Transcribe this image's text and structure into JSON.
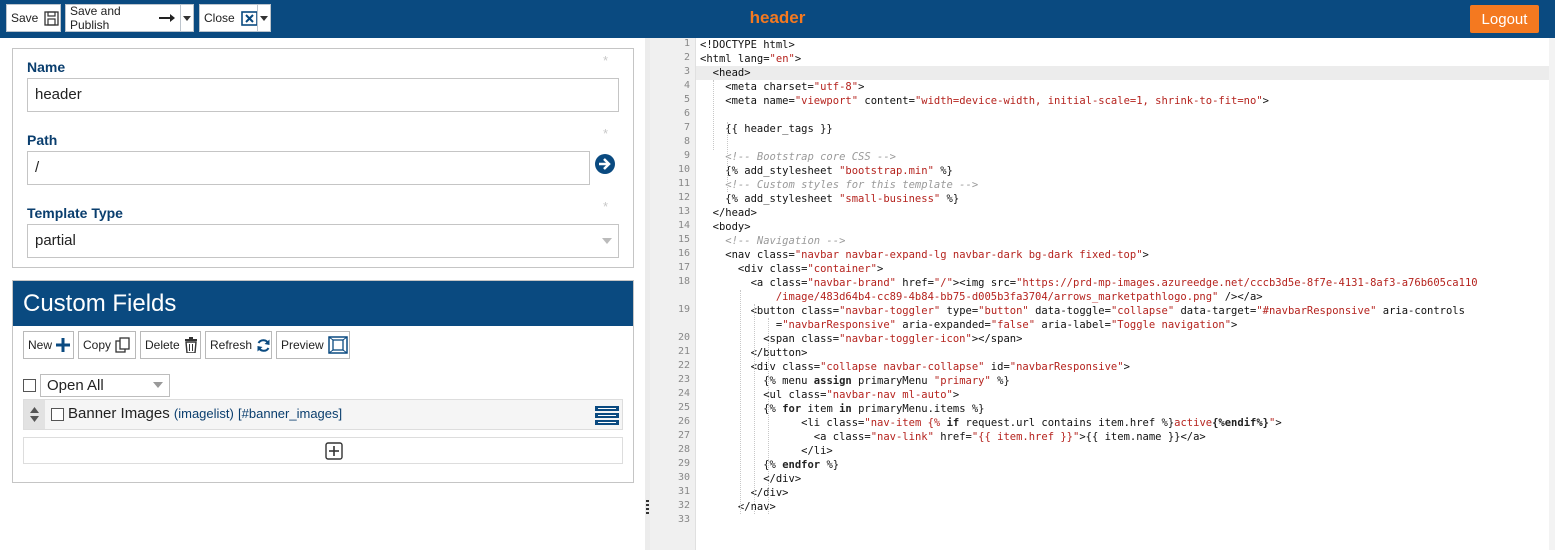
{
  "toolbar": {
    "save_label": "Save",
    "save_publish_label": "Save and Publish",
    "close_label": "Close",
    "title": "header",
    "logout_label": "Logout"
  },
  "form": {
    "name_label": "Name",
    "name_value": "header",
    "path_label": "Path",
    "path_value": "/",
    "template_type_label": "Template Type",
    "template_type_value": "partial",
    "required_marker": "*"
  },
  "custom_fields": {
    "title": "Custom Fields",
    "buttons": [
      "New",
      "Copy",
      "Delete",
      "Refresh",
      "Preview"
    ],
    "open_all": "Open All",
    "rows": [
      {
        "name": "Banner Images",
        "type": "(imagelist)",
        "key": "[#banner_images]"
      }
    ]
  },
  "editor": {
    "line_numbers": [
      "1",
      "2",
      "3",
      "4",
      "5",
      "6",
      "7",
      "8",
      "9",
      "10",
      "11",
      "12",
      "13",
      "14",
      "15",
      "16",
      "17",
      "18",
      "",
      "19",
      "",
      "20",
      "21",
      "22",
      "23",
      "24",
      "25",
      "26",
      "27",
      "28",
      "29",
      "30",
      "31",
      "32",
      "33"
    ],
    "lines": [
      [
        [
          "",
          "<!DOCTYPE html>"
        ]
      ],
      [
        [
          "",
          "<html lang="
        ],
        [
          "s",
          "\"en\""
        ],
        [
          "",
          ">"
        ]
      ],
      [
        [
          "",
          "  <head>"
        ]
      ],
      [
        [
          "",
          "    <meta charset="
        ],
        [
          "s",
          "\"utf-8\""
        ],
        [
          "",
          ">"
        ]
      ],
      [
        [
          "",
          "    <meta name="
        ],
        [
          "s",
          "\"viewport\""
        ],
        [
          "",
          " content="
        ],
        [
          "s",
          "\"width=device-width, initial-scale=1, shrink-to-fit=no\""
        ],
        [
          "",
          ">"
        ]
      ],
      [
        [
          "",
          ""
        ]
      ],
      [
        [
          "",
          "    {{ header_tags }}"
        ]
      ],
      [
        [
          "",
          ""
        ]
      ],
      [
        [
          "c",
          "    <!-- Bootstrap core CSS -->"
        ]
      ],
      [
        [
          "",
          "    {% add_stylesheet "
        ],
        [
          "s",
          "\"bootstrap.min\""
        ],
        [
          "",
          " %}"
        ]
      ],
      [
        [
          "c",
          "    <!-- Custom styles for this template -->"
        ]
      ],
      [
        [
          "",
          "    {% add_stylesheet "
        ],
        [
          "s",
          "\"small-business\""
        ],
        [
          "",
          " %}"
        ]
      ],
      [
        [
          "",
          "  </head>"
        ]
      ],
      [
        [
          "",
          "  <body>"
        ]
      ],
      [
        [
          "c",
          "    <!-- Navigation -->"
        ]
      ],
      [
        [
          "",
          "    <nav class="
        ],
        [
          "s",
          "\"navbar navbar-expand-lg navbar-dark bg-dark fixed-top\""
        ],
        [
          "",
          ">"
        ]
      ],
      [
        [
          "",
          "      <div class="
        ],
        [
          "s",
          "\"container\""
        ],
        [
          "",
          ">"
        ]
      ],
      [
        [
          "",
          "        <a class="
        ],
        [
          "s",
          "\"navbar-brand\""
        ],
        [
          "",
          " href="
        ],
        [
          "s",
          "\"/\""
        ],
        [
          "",
          "><img src="
        ],
        [
          "s",
          "\"https://prd-mp-images.azureedge.net/cccb3d5e-8f7e-4131-8af3-a76b605ca110"
        ]
      ],
      [
        [
          "s",
          "            /image/483d64b4-cc89-4b84-bb75-d005b3fa3704/arrows_marketpathlogo.png\""
        ],
        [
          "",
          " /></a>"
        ]
      ],
      [
        [
          "",
          "        <button class="
        ],
        [
          "s",
          "\"navbar-toggler\""
        ],
        [
          "",
          " type="
        ],
        [
          "s",
          "\"button\""
        ],
        [
          "",
          " data-toggle="
        ],
        [
          "s",
          "\"collapse\""
        ],
        [
          "",
          " data-target="
        ],
        [
          "s",
          "\"#navbarResponsive\""
        ],
        [
          "",
          " aria-controls"
        ]
      ],
      [
        [
          "",
          "            ="
        ],
        [
          "s",
          "\"navbarResponsive\""
        ],
        [
          "",
          " aria-expanded="
        ],
        [
          "s",
          "\"false\""
        ],
        [
          "",
          " aria-label="
        ],
        [
          "s",
          "\"Toggle navigation\""
        ],
        [
          "",
          ">"
        ]
      ],
      [
        [
          "",
          "          <span class="
        ],
        [
          "s",
          "\"navbar-toggler-icon\""
        ],
        [
          "",
          "></span>"
        ]
      ],
      [
        [
          "",
          "        </button>"
        ]
      ],
      [
        [
          "",
          "        <div class="
        ],
        [
          "s",
          "\"collapse navbar-collapse\""
        ],
        [
          "",
          " id="
        ],
        [
          "s",
          "\"navbarResponsive\""
        ],
        [
          "",
          ">"
        ]
      ],
      [
        [
          "",
          "          {% menu "
        ],
        [
          "k",
          "assign"
        ],
        [
          "",
          " primaryMenu "
        ],
        [
          "s",
          "\"primary\""
        ],
        [
          "",
          " %}"
        ]
      ],
      [
        [
          "",
          "          <ul class="
        ],
        [
          "s",
          "\"navbar-nav ml-auto\""
        ],
        [
          "",
          ">"
        ]
      ],
      [
        [
          "",
          "          {% "
        ],
        [
          "k",
          "for"
        ],
        [
          "",
          " item "
        ],
        [
          "k",
          "in"
        ],
        [
          "",
          " primaryMenu.items %}"
        ]
      ],
      [
        [
          "",
          "                <li class="
        ],
        [
          "s",
          "\"nav-item {% "
        ],
        [
          "k",
          "if"
        ],
        [
          "",
          " request.url contains item.href %}"
        ],
        [
          "s",
          "active"
        ],
        [
          "k",
          "{%endif%}"
        ],
        [
          "s",
          "\""
        ],
        [
          "",
          ">"
        ]
      ],
      [
        [
          "",
          "                  <a class="
        ],
        [
          "s",
          "\"nav-link\""
        ],
        [
          "",
          " href="
        ],
        [
          "s",
          "\"{{ item.href }}\""
        ],
        [
          "",
          ">{{ item.name }}</a>"
        ]
      ],
      [
        [
          "",
          "                </li>"
        ]
      ],
      [
        [
          "",
          "          {% "
        ],
        [
          "k",
          "endfor"
        ],
        [
          "",
          " %}"
        ]
      ],
      [
        [
          "",
          "          </div>"
        ]
      ],
      [
        [
          "",
          "        </div>"
        ]
      ],
      [
        [
          "",
          "      </nav>"
        ]
      ],
      [
        [
          "",
          ""
        ]
      ]
    ]
  },
  "colors": {
    "header_bg": "#0a4a80",
    "title_orange": "#f47920",
    "string_red": "#b5231e"
  },
  "icons": [
    "save-icon",
    "arrow-right-icon",
    "close-box-icon",
    "chevron-down-icon",
    "go-arrow-icon",
    "plus-icon",
    "copy-icon",
    "trash-icon",
    "refresh-icon",
    "preview-icon",
    "drag-sort-icon",
    "list-menu-icon",
    "add-box-icon"
  ]
}
